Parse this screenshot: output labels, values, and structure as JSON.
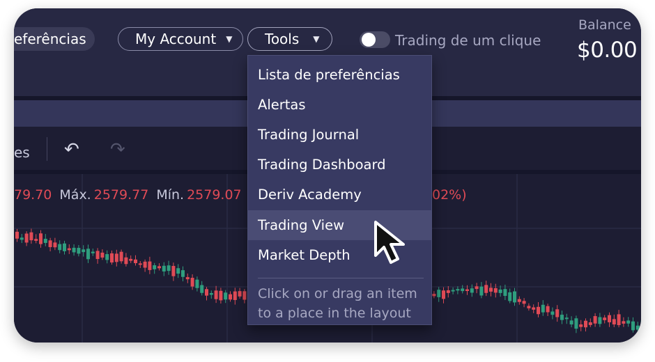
{
  "header": {
    "preferences_tab": "eferências",
    "my_account_label": "My Account",
    "tools_label": "Tools",
    "caret": "▼",
    "one_click_trading_label": "Trading de um clique",
    "one_click_trading_on": false,
    "balance_label": "Balance",
    "balance_value": "$0.00"
  },
  "chart_toolbar": {
    "partial_label": "es",
    "undo_icon": "undo-icon",
    "redo_icon": "redo-icon",
    "undo_glyph": "↶",
    "redo_glyph": "↷"
  },
  "ohlc": {
    "open_value": "79.70",
    "high_label": "Máx.",
    "high_value": "2579.77",
    "low_label": "Mín.",
    "low_value": "2579.07",
    "change_pct": "02%)"
  },
  "tools_menu": {
    "items": [
      "Lista de preferências",
      "Alertas",
      "Trading Journal",
      "Trading Dashboard",
      "Deriv Academy",
      "Trading View",
      "Market Depth"
    ],
    "hovered_item": "Trading View",
    "hint": "Click on or drag an item to a place in the layout"
  },
  "colors": {
    "up": "#2f9e7e",
    "down": "#e04b56",
    "background": "#1d1d33",
    "menu_bg": "#383a62"
  }
}
